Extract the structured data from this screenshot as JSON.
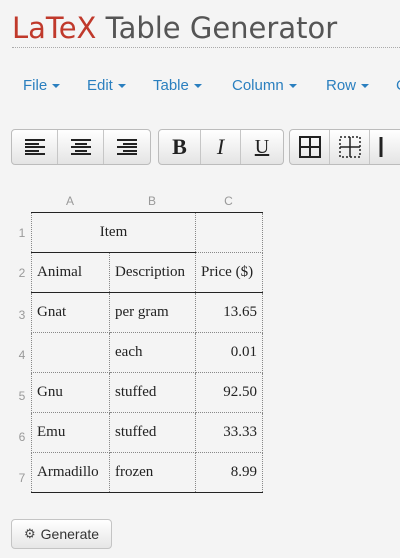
{
  "header": {
    "title_brand": "LaTeX",
    "title_rest": " Table Generator"
  },
  "menu": [
    {
      "label": "File"
    },
    {
      "label": "Edit"
    },
    {
      "label": "Table"
    },
    {
      "label": "Column"
    },
    {
      "label": "Row"
    },
    {
      "label": "C"
    }
  ],
  "toolbar": {
    "bold": "B",
    "italic": "I",
    "underline": "U"
  },
  "columns": [
    "A",
    "B",
    "C"
  ],
  "rows": [
    "1",
    "2",
    "3",
    "4",
    "5",
    "6",
    "7"
  ],
  "table": {
    "r1": {
      "c1": "Item",
      "c3": ""
    },
    "r2": {
      "c1": "Animal",
      "c2": "Description",
      "c3": "Price ($)"
    },
    "r3": {
      "c1": "Gnat",
      "c2": "per gram",
      "c3": "13.65"
    },
    "r4": {
      "c1": "",
      "c2": "each",
      "c3": "0.01"
    },
    "r5": {
      "c1": "Gnu",
      "c2": "stuffed",
      "c3": "92.50"
    },
    "r6": {
      "c1": "Emu",
      "c2": "stuffed",
      "c3": "33.33"
    },
    "r7": {
      "c1": "Armadillo",
      "c2": "frozen",
      "c3": "8.99"
    }
  },
  "generate_label": "Generate"
}
